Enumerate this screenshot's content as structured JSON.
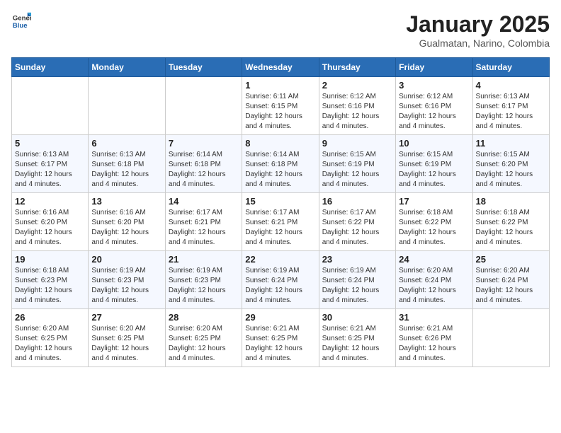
{
  "logo": {
    "general": "General",
    "blue": "Blue"
  },
  "header": {
    "month_title": "January 2025",
    "subtitle": "Gualmatan, Narino, Colombia"
  },
  "weekdays": [
    "Sunday",
    "Monday",
    "Tuesday",
    "Wednesday",
    "Thursday",
    "Friday",
    "Saturday"
  ],
  "weeks": [
    [
      {
        "day": "",
        "sunrise": "",
        "sunset": "",
        "daylight": ""
      },
      {
        "day": "",
        "sunrise": "",
        "sunset": "",
        "daylight": ""
      },
      {
        "day": "",
        "sunrise": "",
        "sunset": "",
        "daylight": ""
      },
      {
        "day": "1",
        "sunrise": "Sunrise: 6:11 AM",
        "sunset": "Sunset: 6:15 PM",
        "daylight": "Daylight: 12 hours and 4 minutes."
      },
      {
        "day": "2",
        "sunrise": "Sunrise: 6:12 AM",
        "sunset": "Sunset: 6:16 PM",
        "daylight": "Daylight: 12 hours and 4 minutes."
      },
      {
        "day": "3",
        "sunrise": "Sunrise: 6:12 AM",
        "sunset": "Sunset: 6:16 PM",
        "daylight": "Daylight: 12 hours and 4 minutes."
      },
      {
        "day": "4",
        "sunrise": "Sunrise: 6:13 AM",
        "sunset": "Sunset: 6:17 PM",
        "daylight": "Daylight: 12 hours and 4 minutes."
      }
    ],
    [
      {
        "day": "5",
        "sunrise": "Sunrise: 6:13 AM",
        "sunset": "Sunset: 6:17 PM",
        "daylight": "Daylight: 12 hours and 4 minutes."
      },
      {
        "day": "6",
        "sunrise": "Sunrise: 6:13 AM",
        "sunset": "Sunset: 6:18 PM",
        "daylight": "Daylight: 12 hours and 4 minutes."
      },
      {
        "day": "7",
        "sunrise": "Sunrise: 6:14 AM",
        "sunset": "Sunset: 6:18 PM",
        "daylight": "Daylight: 12 hours and 4 minutes."
      },
      {
        "day": "8",
        "sunrise": "Sunrise: 6:14 AM",
        "sunset": "Sunset: 6:18 PM",
        "daylight": "Daylight: 12 hours and 4 minutes."
      },
      {
        "day": "9",
        "sunrise": "Sunrise: 6:15 AM",
        "sunset": "Sunset: 6:19 PM",
        "daylight": "Daylight: 12 hours and 4 minutes."
      },
      {
        "day": "10",
        "sunrise": "Sunrise: 6:15 AM",
        "sunset": "Sunset: 6:19 PM",
        "daylight": "Daylight: 12 hours and 4 minutes."
      },
      {
        "day": "11",
        "sunrise": "Sunrise: 6:15 AM",
        "sunset": "Sunset: 6:20 PM",
        "daylight": "Daylight: 12 hours and 4 minutes."
      }
    ],
    [
      {
        "day": "12",
        "sunrise": "Sunrise: 6:16 AM",
        "sunset": "Sunset: 6:20 PM",
        "daylight": "Daylight: 12 hours and 4 minutes."
      },
      {
        "day": "13",
        "sunrise": "Sunrise: 6:16 AM",
        "sunset": "Sunset: 6:20 PM",
        "daylight": "Daylight: 12 hours and 4 minutes."
      },
      {
        "day": "14",
        "sunrise": "Sunrise: 6:17 AM",
        "sunset": "Sunset: 6:21 PM",
        "daylight": "Daylight: 12 hours and 4 minutes."
      },
      {
        "day": "15",
        "sunrise": "Sunrise: 6:17 AM",
        "sunset": "Sunset: 6:21 PM",
        "daylight": "Daylight: 12 hours and 4 minutes."
      },
      {
        "day": "16",
        "sunrise": "Sunrise: 6:17 AM",
        "sunset": "Sunset: 6:22 PM",
        "daylight": "Daylight: 12 hours and 4 minutes."
      },
      {
        "day": "17",
        "sunrise": "Sunrise: 6:18 AM",
        "sunset": "Sunset: 6:22 PM",
        "daylight": "Daylight: 12 hours and 4 minutes."
      },
      {
        "day": "18",
        "sunrise": "Sunrise: 6:18 AM",
        "sunset": "Sunset: 6:22 PM",
        "daylight": "Daylight: 12 hours and 4 minutes."
      }
    ],
    [
      {
        "day": "19",
        "sunrise": "Sunrise: 6:18 AM",
        "sunset": "Sunset: 6:23 PM",
        "daylight": "Daylight: 12 hours and 4 minutes."
      },
      {
        "day": "20",
        "sunrise": "Sunrise: 6:19 AM",
        "sunset": "Sunset: 6:23 PM",
        "daylight": "Daylight: 12 hours and 4 minutes."
      },
      {
        "day": "21",
        "sunrise": "Sunrise: 6:19 AM",
        "sunset": "Sunset: 6:23 PM",
        "daylight": "Daylight: 12 hours and 4 minutes."
      },
      {
        "day": "22",
        "sunrise": "Sunrise: 6:19 AM",
        "sunset": "Sunset: 6:24 PM",
        "daylight": "Daylight: 12 hours and 4 minutes."
      },
      {
        "day": "23",
        "sunrise": "Sunrise: 6:19 AM",
        "sunset": "Sunset: 6:24 PM",
        "daylight": "Daylight: 12 hours and 4 minutes."
      },
      {
        "day": "24",
        "sunrise": "Sunrise: 6:20 AM",
        "sunset": "Sunset: 6:24 PM",
        "daylight": "Daylight: 12 hours and 4 minutes."
      },
      {
        "day": "25",
        "sunrise": "Sunrise: 6:20 AM",
        "sunset": "Sunset: 6:24 PM",
        "daylight": "Daylight: 12 hours and 4 minutes."
      }
    ],
    [
      {
        "day": "26",
        "sunrise": "Sunrise: 6:20 AM",
        "sunset": "Sunset: 6:25 PM",
        "daylight": "Daylight: 12 hours and 4 minutes."
      },
      {
        "day": "27",
        "sunrise": "Sunrise: 6:20 AM",
        "sunset": "Sunset: 6:25 PM",
        "daylight": "Daylight: 12 hours and 4 minutes."
      },
      {
        "day": "28",
        "sunrise": "Sunrise: 6:20 AM",
        "sunset": "Sunset: 6:25 PM",
        "daylight": "Daylight: 12 hours and 4 minutes."
      },
      {
        "day": "29",
        "sunrise": "Sunrise: 6:21 AM",
        "sunset": "Sunset: 6:25 PM",
        "daylight": "Daylight: 12 hours and 4 minutes."
      },
      {
        "day": "30",
        "sunrise": "Sunrise: 6:21 AM",
        "sunset": "Sunset: 6:25 PM",
        "daylight": "Daylight: 12 hours and 4 minutes."
      },
      {
        "day": "31",
        "sunrise": "Sunrise: 6:21 AM",
        "sunset": "Sunset: 6:26 PM",
        "daylight": "Daylight: 12 hours and 4 minutes."
      },
      {
        "day": "",
        "sunrise": "",
        "sunset": "",
        "daylight": ""
      }
    ]
  ]
}
